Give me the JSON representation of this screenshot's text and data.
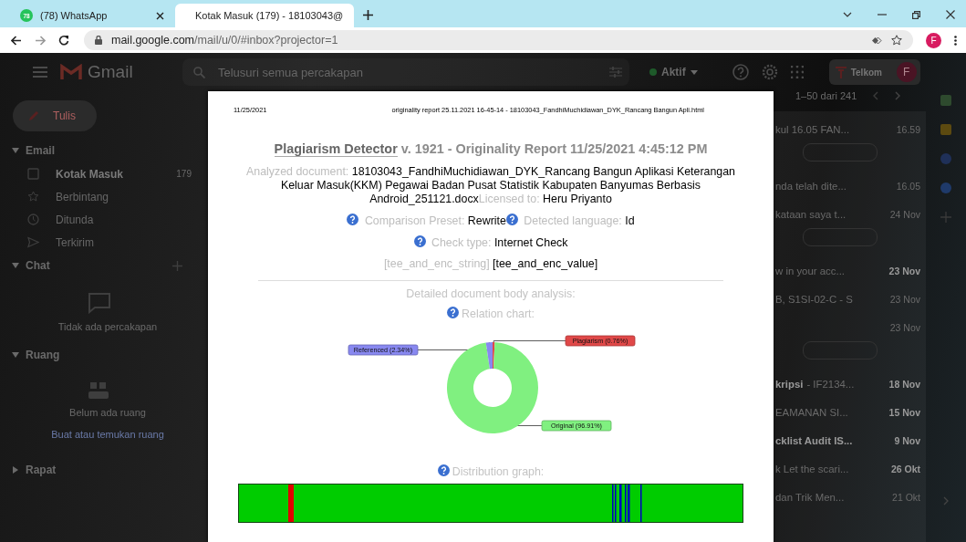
{
  "browser": {
    "tabs": [
      {
        "kind": "whatsapp",
        "title": "(78) WhatsApp",
        "badge": "78",
        "selected": false
      },
      {
        "kind": "gmail",
        "title": "Kotak Masuk (179) - 18103043@",
        "selected": true
      }
    ],
    "url_domain": "mail.google.com",
    "url_path": "/mail/u/0/#inbox?projector=1",
    "forward_disabled": true,
    "profile_initial": "F"
  },
  "gmail": {
    "logo_text": "Gmail",
    "search_placeholder": "Telusuri semua percakapan",
    "status": "Aktif",
    "org_name": "Telkom",
    "avatar_initial": "F"
  },
  "sidebar": {
    "compose": "Tulis",
    "email_section": {
      "title": "Email",
      "expanded": true
    },
    "folders": [
      {
        "kind": "inbox",
        "label": "Kotak Masuk",
        "count": "179",
        "selected": true
      },
      {
        "kind": "star",
        "label": "Berbintang",
        "selected": false
      },
      {
        "kind": "clock",
        "label": "Ditunda",
        "selected": false
      },
      {
        "kind": "send",
        "label": "Terkirim",
        "selected": false
      }
    ],
    "chat_section": {
      "title": "Chat",
      "expanded": true
    },
    "chat_empty": "Tidak ada percakapan",
    "spaces_section": {
      "title": "Ruang",
      "expanded": true
    },
    "spaces_empty": "Belum ada ruang",
    "spaces_link": "Buat atau temukan ruang",
    "meet_section": {
      "title": "Rapat",
      "expanded": false
    }
  },
  "mail_list": {
    "range": "1–50 dari 241",
    "rows": [
      {
        "snippet": "kul 16.05 FAN...",
        "date": "16.59",
        "unread": false,
        "attachment": true
      },
      {
        "snippet": "nda telah dite...",
        "date": "16.05",
        "unread": false,
        "attachment": false
      },
      {
        "snippet": "kataan saya t...",
        "date": "24 Nov",
        "unread": false,
        "attachment": true
      },
      {
        "snippet": "w in your acc...",
        "date": "23 Nov",
        "unread": true,
        "attachment": false
      },
      {
        "snippet": "B, S1SI-02-C - S",
        "date": "23 Nov",
        "unread": false,
        "attachment": false
      },
      {
        "date": "23 Nov",
        "unread": false,
        "attachment": true
      },
      {
        "subject": "kripsi",
        "snippet": "- IF2134...",
        "date": "18 Nov",
        "unread": true,
        "attachment": false
      },
      {
        "snippet": "EAMANAN SI...",
        "date": "15 Nov",
        "unread": true,
        "attachment": false
      },
      {
        "subject": "cklist Audit IS...",
        "date": "9 Nov",
        "unread": true,
        "attachment": false
      },
      {
        "snippet": "k Let the scari...",
        "date": "26 Okt",
        "unread": true,
        "attachment": false
      },
      {
        "snippet": "dan Trik Men...",
        "date": "21 Okt",
        "unread": false,
        "attachment": false
      }
    ]
  },
  "side_panel": {
    "apps": [
      {
        "kind": "calendar"
      },
      {
        "kind": "keep"
      },
      {
        "kind": "tasks"
      },
      {
        "kind": "contacts"
      },
      {
        "kind": "add"
      }
    ]
  },
  "report": {
    "print_date": "11/25/2021",
    "print_title": "originality report 25.11.2021 16-45-14 - 18103043_FandhiMuchidiawan_DYK_Rancang Bangun Apli.html",
    "title_link": "Plagiarism Detector",
    "title_rest": "v. 1921 - Originality Report 11/25/2021 4:45:12 PM",
    "lines": [
      [
        {
          "help": false,
          "label": "Analyzed document:",
          "value": "18103043_FandhiMuchidiawan_DYK_Rancang Bangun Aplikasi Keterangan Keluar Masuk(KKM) Pegawai Badan Pusat Statistik Kabupaten Banyumas Berbasis Android_251121.docx"
        },
        {
          "help": false,
          "label": "Licensed to:",
          "value": "Heru Priyanto"
        }
      ],
      [
        {
          "help": true,
          "label": "Comparison Preset:",
          "value": "Rewrite"
        },
        {
          "help": true,
          "label": "Detected language:",
          "value": "Id"
        }
      ],
      [
        {
          "help": true,
          "label": "Check type:",
          "value": "Internet Check"
        }
      ],
      [
        {
          "help": false,
          "label": "[tee_and_enc_string]",
          "value": "[tee_and_enc_value]"
        }
      ]
    ],
    "section_title": "Detailed document body analysis:",
    "relation_title": "Relation chart:",
    "chart_data": {
      "type": "donut",
      "categories": [
        "Plagiarism",
        "Original",
        "Referenced"
      ],
      "values": [
        0.76,
        96.91,
        2.34
      ],
      "value_labels": [
        "(0.76%)",
        "(96.91%)",
        "(2.34%)"
      ]
    },
    "distribution_title": "Distribution graph:"
  }
}
